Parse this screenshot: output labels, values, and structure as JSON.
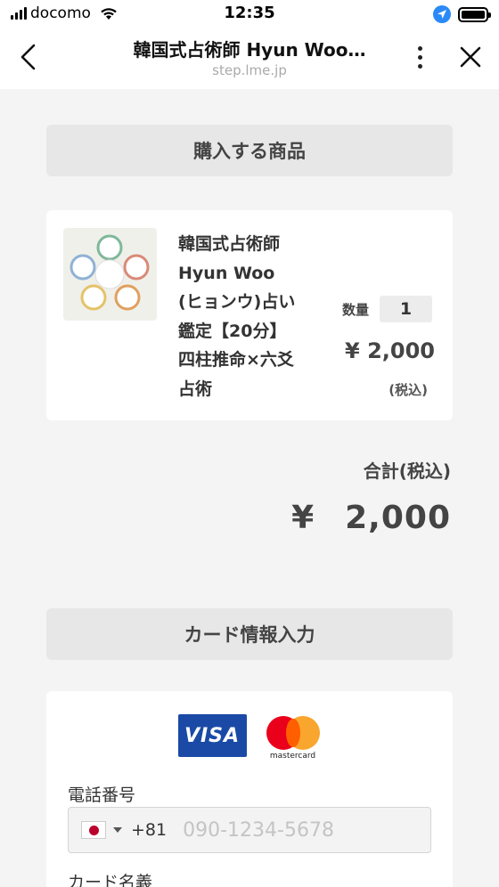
{
  "status_bar": {
    "carrier": "docomo",
    "time": "12:35"
  },
  "nav": {
    "title": "韓国式占術師 Hyun Woo…",
    "subtitle": "step.lme.jp"
  },
  "product_section": {
    "header": "購入する商品",
    "item": {
      "name_lines": [
        "韓国式占術師",
        "Hyun Woo",
        "(ヒョンウ)占い",
        "鑑定【20分】",
        "四柱推命×六爻",
        "占術"
      ],
      "quantity_label": "数量",
      "quantity": "1",
      "price": "¥ 2,000",
      "tax_note": "(税込)"
    }
  },
  "total": {
    "label": "合計(税込)",
    "currency": "¥",
    "amount": "2,000"
  },
  "card_section": {
    "header": "カード情報入力",
    "brands": {
      "visa": "VISA",
      "mastercard": "mastercard"
    },
    "phone_label": "電話番号",
    "country_code": "+81",
    "phone_placeholder": "090-1234-5678",
    "card_name_label": "カード名義"
  }
}
